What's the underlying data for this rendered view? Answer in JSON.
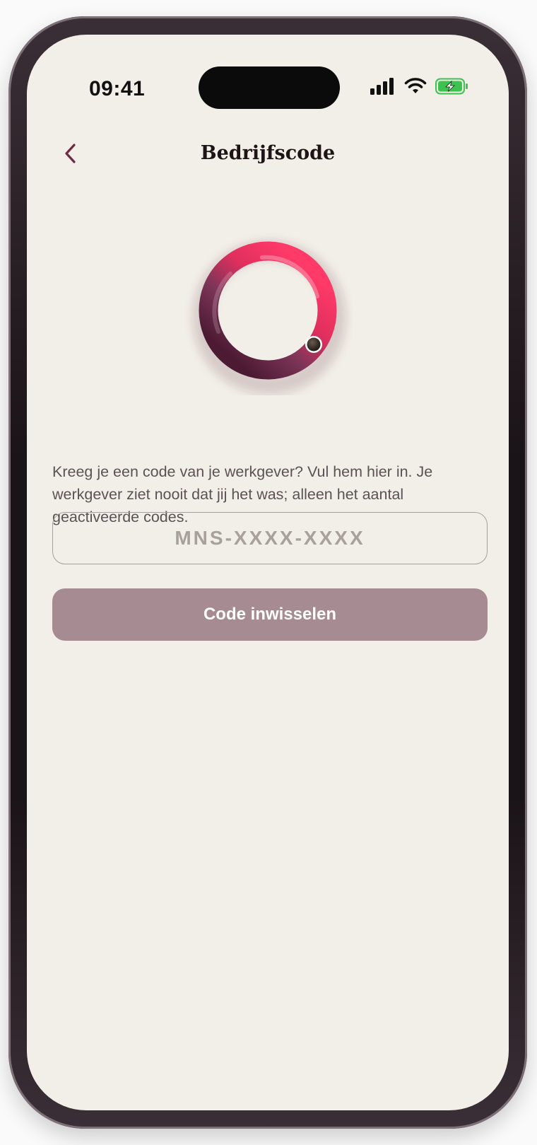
{
  "status_bar": {
    "time": "09:41",
    "icons": [
      "cellular-signal-icon",
      "wifi-icon",
      "battery-charging-icon"
    ]
  },
  "nav": {
    "back_icon": "chevron-left-icon",
    "title": "Bedrijfscode"
  },
  "illustration": {
    "icon": "ring-icon"
  },
  "form": {
    "description": "Kreeg je een code van je werkgever? Vul hem hier in. Je werkgever ziet nooit dat jij het was; alleen het aantal geactiveerde codes.",
    "code_value": "",
    "code_placeholder": "MNS-XXXX-XXXX",
    "submit_label": "Code inwisselen"
  },
  "colors": {
    "background": "#f2efe8",
    "accent": "#6e2a45",
    "ring_pink": "#ee3462",
    "button_disabled": "#a68b93",
    "battery_green": "#3ec24f"
  }
}
